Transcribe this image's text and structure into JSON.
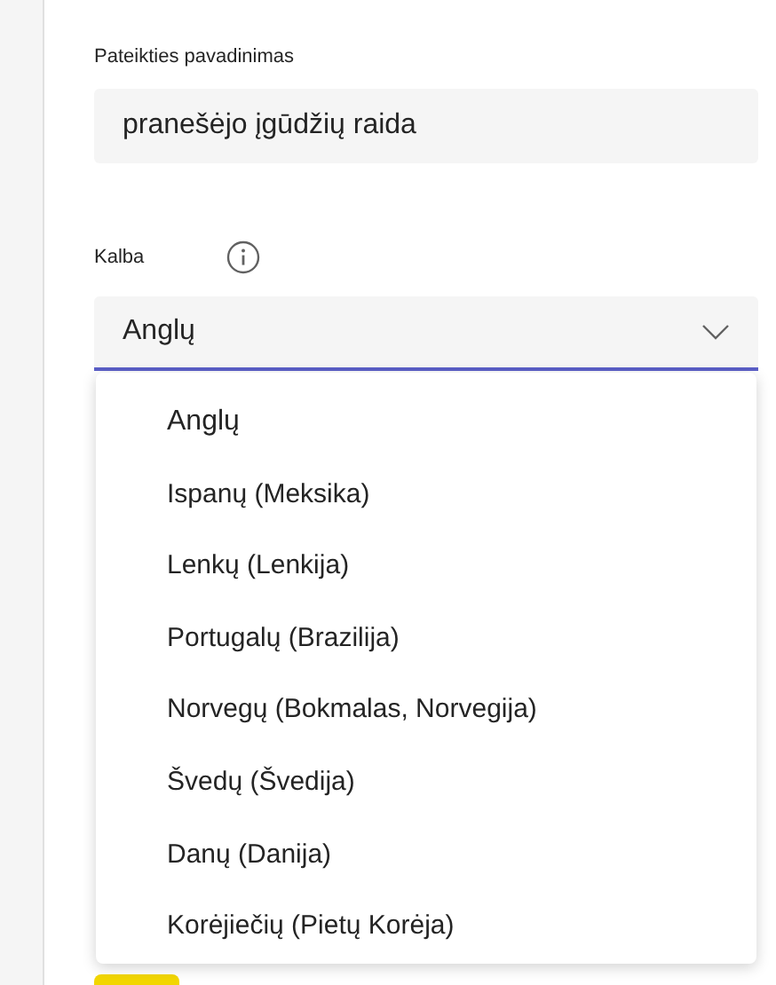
{
  "title_field": {
    "label": "Pateikties pavadinimas",
    "value": "pranešėjo įgūdžių raida"
  },
  "language": {
    "label": "Kalba",
    "value": "Anglų",
    "expanded": true,
    "options": [
      {
        "label": "Anglų"
      },
      {
        "label": "Ispanų (Meksika)"
      },
      {
        "label": "Lenkų (Lenkija)"
      },
      {
        "label": "Portugalų (Brazilija)"
      },
      {
        "label": "Norvegų (Bokmalas, Norvegija)"
      },
      {
        "label": "Švedų (Švedija)"
      },
      {
        "label": "Danų (Danija)"
      },
      {
        "label": "Korėjiečių (Pietų Korėja)"
      }
    ]
  }
}
